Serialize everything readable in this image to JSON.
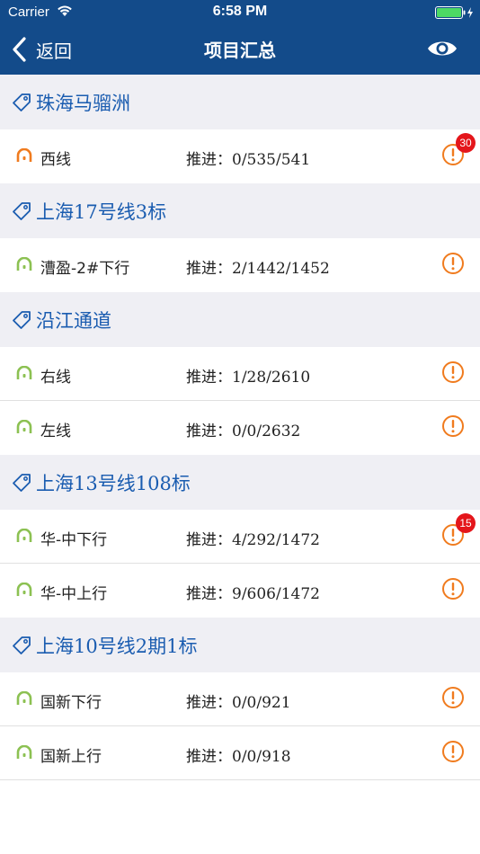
{
  "status_bar": {
    "carrier": "Carrier",
    "time": "6:58 PM"
  },
  "nav": {
    "back_label": "返回",
    "title": "项目汇总"
  },
  "colors": {
    "nav_bg": "#134b8a",
    "group_title": "#1a5cb0",
    "alert": "#f07b1e",
    "badge": "#e4161b",
    "active_orange": "#f07b1e",
    "active_green": "#8cc152"
  },
  "progress_label": "推进：",
  "groups": [
    {
      "title": "珠海马骝洲",
      "rows": [
        {
          "name": "西线",
          "progress": "0/535/541",
          "icon_color": "orange",
          "badge": "30"
        }
      ]
    },
    {
      "title": "上海17号线3标",
      "rows": [
        {
          "name": "漕盈-2#下行",
          "progress": "2/1442/1452",
          "icon_color": "green"
        }
      ]
    },
    {
      "title": "沿江通道",
      "rows": [
        {
          "name": "右线",
          "progress": "1/28/2610",
          "icon_color": "green"
        },
        {
          "name": "左线",
          "progress": "0/0/2632",
          "icon_color": "green"
        }
      ]
    },
    {
      "title": "上海13号线108标",
      "rows": [
        {
          "name": "华-中下行",
          "progress": "4/292/1472",
          "icon_color": "green",
          "badge": "15"
        },
        {
          "name": "华-中上行",
          "progress": "9/606/1472",
          "icon_color": "green"
        }
      ]
    },
    {
      "title": "上海10号线2期1标",
      "rows": [
        {
          "name": "国新下行",
          "progress": "0/0/921",
          "icon_color": "green"
        },
        {
          "name": "国新上行",
          "progress": "0/0/918",
          "icon_color": "green"
        }
      ]
    }
  ]
}
